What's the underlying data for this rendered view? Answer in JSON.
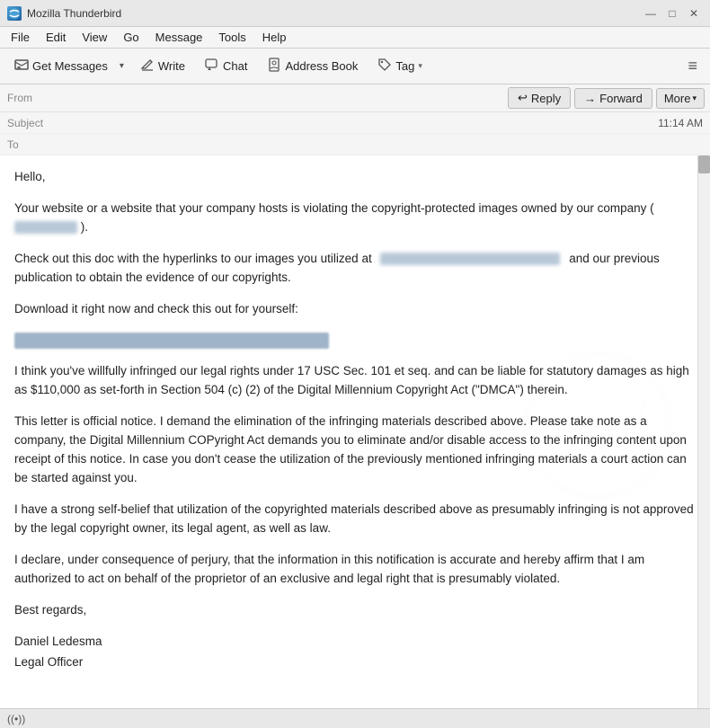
{
  "titleBar": {
    "title": "Mozilla Thunderbird",
    "icon": "🐦",
    "controls": {
      "minimize": "—",
      "maximize": "□",
      "close": "✕"
    }
  },
  "menuBar": {
    "items": [
      "File",
      "Edit",
      "View",
      "Go",
      "Message",
      "Tools",
      "Help"
    ]
  },
  "toolbar": {
    "getMessages": "Get Messages",
    "write": "Write",
    "chat": "Chat",
    "addressBook": "Address Book",
    "tag": "Tag",
    "hamburger": "≡"
  },
  "emailHeader": {
    "fromLabel": "From",
    "subjectLabel": "Subject",
    "toLabel": "To",
    "time": "11:14 AM"
  },
  "actionButtons": {
    "reply": "Reply",
    "forward": "Forward",
    "more": "More"
  },
  "emailBody": {
    "greeting": "Hello,",
    "paragraph1a": "Your website or a website that your company hosts is violating the copyright-protected images owned by our company (",
    "paragraph1b": ").",
    "paragraph2a": "Check out this doc with the hyperlinks to our images you utilized at",
    "paragraph2b": "and our previous publication to obtain the evidence of our copyrights.",
    "paragraph3": "Download it right now and check this out for yourself:",
    "paragraph4": "I think you've willfully infringed our legal rights under 17 USC Sec. 101 et seq. and can be liable for statutory damages as high as $110,000 as set-forth in Section 504 (c) (2) of the Digital Millennium Copyright Act (\"DMCA\") therein.",
    "paragraph5": "This letter is official notice. I demand the elimination of the infringing materials described above. Please take note as a company, the Digital Millennium COPyright Act demands you to eliminate and/or disable access to the infringing content upon receipt of this notice. In case you don't cease the utilization of the previously mentioned infringing materials a court action can be started against you.",
    "paragraph6": "I have a strong self-belief that utilization of the copyrighted materials described above as presumably infringing is not approved by the legal copyright owner, its legal agent, as well as law.",
    "paragraph7": "I declare, under consequence of perjury, that the information in this notification is accurate and hereby affirm that I am authorized to act on behalf of the proprietor of an exclusive and legal right that is presumably violated.",
    "closing": "Best regards,",
    "name": "Daniel Ledesma",
    "title": "Legal Officer"
  },
  "statusBar": {
    "icon": "((•))"
  }
}
